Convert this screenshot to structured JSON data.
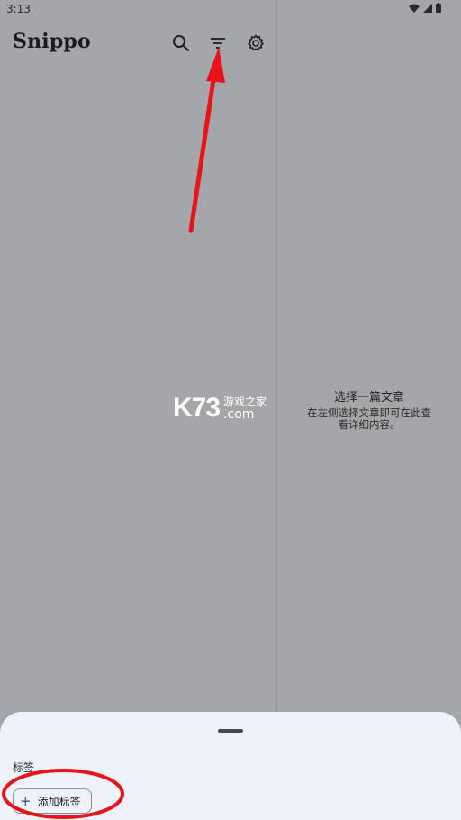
{
  "status_bar": {
    "time": "3:13"
  },
  "app": {
    "title": "Snippo"
  },
  "toolbar": {
    "search_icon": "search-icon",
    "filter_icon": "filter-icon",
    "settings_icon": "gear-icon"
  },
  "detail": {
    "empty_title": "选择一篇文章",
    "empty_desc_line1": "在左侧选择文章即可在此查",
    "empty_desc_line2": "看详细内容。"
  },
  "watermark": {
    "logo": "K73",
    "name": "游戏之家",
    "domain": ".com"
  },
  "bottom_sheet": {
    "tags_label": "标签",
    "add_tag_label": "添加标签"
  },
  "annotations": {
    "arrow_color": "#e8141a",
    "circle_color": "#e8141a"
  },
  "colors": {
    "background": "#a5a6a9",
    "sheet": "#eef2fb",
    "accent": "#3b4a7a"
  }
}
